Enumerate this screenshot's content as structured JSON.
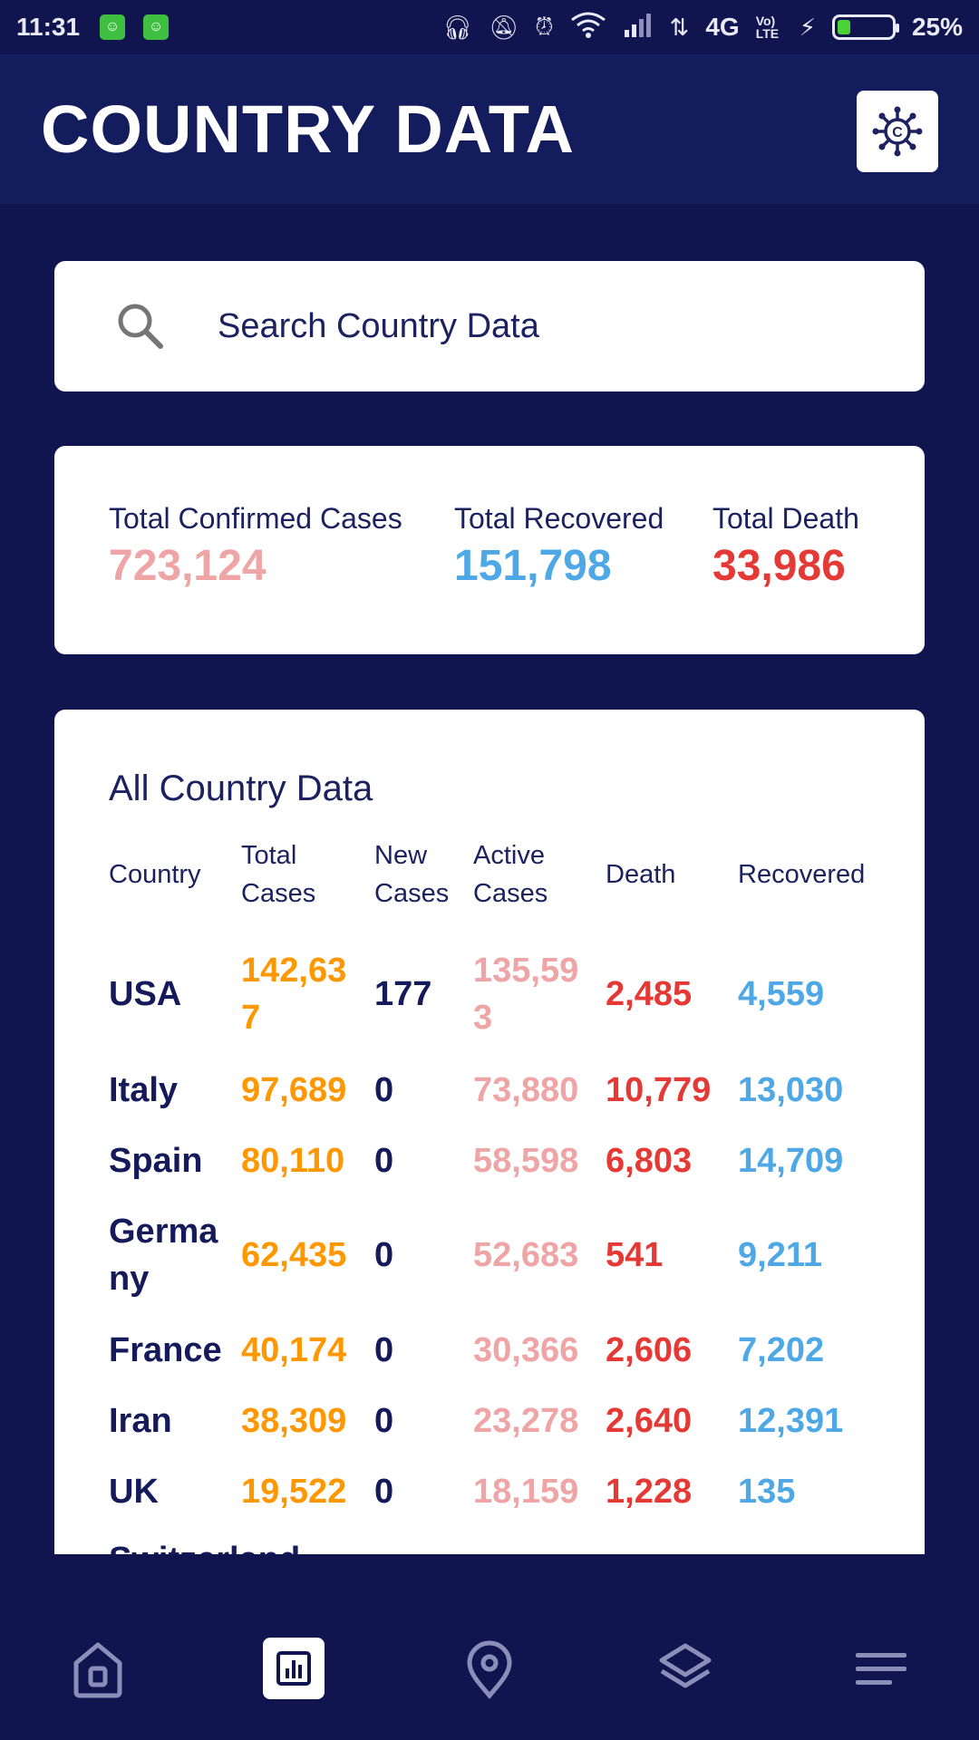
{
  "status_bar": {
    "time": "11:31",
    "network": "4G",
    "volte": "Vo) LTE",
    "battery": "25%"
  },
  "header": {
    "title": "COUNTRY DATA",
    "icon": "virus-icon"
  },
  "search": {
    "placeholder": "Search Country Data",
    "icon": "search-icon"
  },
  "totals": {
    "confirmed_label": "Total Confirmed Cases",
    "confirmed_value": "723,124",
    "recovered_label": "Total Recovered",
    "recovered_value": "151,798",
    "death_label": "Total Death",
    "death_value": "33,986"
  },
  "table": {
    "title": "All Country Data",
    "headers": [
      "Country",
      "Total Cases",
      "New Cases",
      "Active Cases",
      "Death",
      "Recovered"
    ],
    "rows": [
      {
        "country": "USA",
        "total": "142,637",
        "new": "177",
        "active": "135,593",
        "death": "2,485",
        "recovered": "4,559"
      },
      {
        "country": "Italy",
        "total": "97,689",
        "new": "0",
        "active": "73,880",
        "death": "10,779",
        "recovered": "13,030"
      },
      {
        "country": "Spain",
        "total": "80,110",
        "new": "0",
        "active": "58,598",
        "death": "6,803",
        "recovered": "14,709"
      },
      {
        "country": "Germany",
        "total": "62,435",
        "new": "0",
        "active": "52,683",
        "death": "541",
        "recovered": "9,211"
      },
      {
        "country": "France",
        "total": "40,174",
        "new": "0",
        "active": "30,366",
        "death": "2,606",
        "recovered": "7,202"
      },
      {
        "country": "Iran",
        "total": "38,309",
        "new": "0",
        "active": "23,278",
        "death": "2,640",
        "recovered": "12,391"
      },
      {
        "country": "UK",
        "total": "19,522",
        "new": "0",
        "active": "18,159",
        "death": "1,228",
        "recovered": "135"
      },
      {
        "country": "Switzerland",
        "total": "",
        "new": "",
        "active": "",
        "death": "",
        "recovered": ""
      }
    ]
  },
  "colors": {
    "background": "#10154f",
    "total_cases": "#ff9800",
    "active_cases": "#efa4a6",
    "death": "#e53935",
    "recovered": "#4ea8e6"
  },
  "nav": [
    "home-icon",
    "stats-icon",
    "location-icon",
    "layers-icon",
    "menu-icon"
  ]
}
